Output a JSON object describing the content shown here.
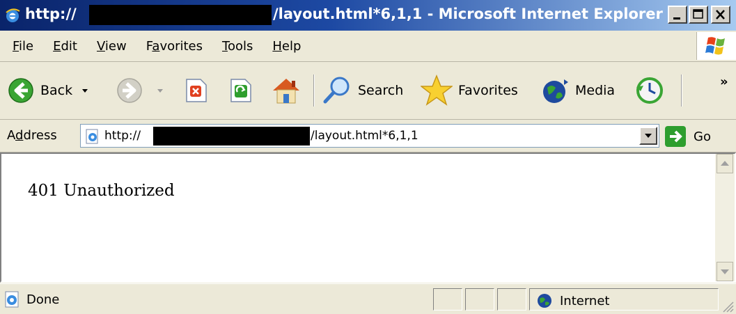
{
  "window": {
    "title_prefix": "http://",
    "title_suffix": "/layout.html*6,1,1 - Microsoft Internet Explorer"
  },
  "menubar": {
    "items": [
      {
        "accel": "F",
        "rest": "ile"
      },
      {
        "accel": "E",
        "rest": "dit"
      },
      {
        "accel": "V",
        "rest": "iew"
      },
      {
        "pre": "F",
        "accel": "a",
        "rest": "vorites"
      },
      {
        "accel": "T",
        "rest": "ools"
      },
      {
        "accel": "H",
        "rest": "elp"
      }
    ]
  },
  "toolbar": {
    "back_label": "Back",
    "search_label": "Search",
    "favorites_label": "Favorites",
    "media_label": "Media",
    "chevron": "»"
  },
  "address": {
    "label_pre": "A",
    "label_accel": "d",
    "label_rest": "dress",
    "url_prefix": "http://",
    "url_suffix": "/layout.html*6,1,1",
    "go_label": "Go"
  },
  "content": {
    "text": "401 Unauthorized"
  },
  "status": {
    "text": "Done",
    "zone": "Internet"
  },
  "colors": {
    "title_start": "#0a246a",
    "title_end": "#a6caf0",
    "chrome": "#ece9d8"
  }
}
